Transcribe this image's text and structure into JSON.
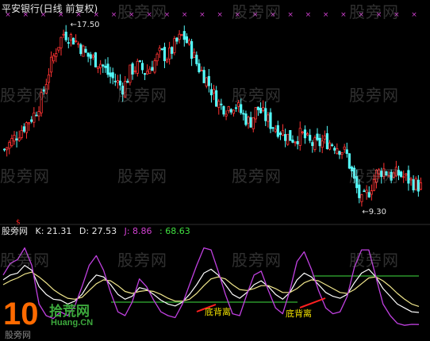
{
  "header": {
    "title": "平安银行(日线 前复权)"
  },
  "indicator": {
    "name": "股旁网",
    "k_label": "K: 21.31",
    "d_label": "D: 27.53",
    "j_label": "J: 8.86",
    "x_label": ": 68.63"
  },
  "watermark": "股旁网",
  "logo": {
    "num": "10",
    "cn": "拾荒网",
    "url": "Huang.CN",
    "sub": "股旁网"
  },
  "colors": {
    "up": "#ff3232",
    "down": "#54fcfc",
    "marker": "#d040d0",
    "k_line": "#ffffff",
    "d_line": "#f0e68c",
    "j_line": "#c040e0",
    "level_line": "#40e040",
    "annotation": "#f0e000",
    "red_marker": "#ff2020"
  },
  "chart_data": [
    {
      "type": "candlestick",
      "title": "平安银行(日线 前复权)",
      "annotations": [
        {
          "text": "17.50",
          "kind": "high"
        },
        {
          "text": "9.30",
          "kind": "low"
        }
      ],
      "marker_rows": {
        "x_marks": 24,
        "note": "x markers across top"
      },
      "close_path": [
        12.0,
        12.4,
        12.8,
        13.2,
        13.6,
        14.3,
        15.6,
        16.6,
        17.3,
        17.1,
        16.8,
        16.3,
        16.1,
        15.9,
        15.4,
        15.1,
        14.8,
        15.6,
        15.8,
        15.5,
        15.9,
        16.4,
        16.2,
        16.8,
        17.2,
        16.6,
        15.8,
        15.3,
        14.6,
        14.0,
        13.9,
        14.1,
        13.6,
        13.2,
        13.9,
        13.5,
        13.1,
        12.9,
        12.6,
        12.5,
        12.7,
        12.3,
        12.2,
        12.4,
        12.3,
        12.1,
        11.8,
        10.6,
        9.6,
        10.1,
        10.9,
        11.1,
        10.8,
        10.9,
        10.7,
        10.5,
        10.3
      ]
    },
    {
      "type": "line",
      "title": "股旁网",
      "series": [
        {
          "name": "K",
          "values": [
            55,
            60,
            62,
            70,
            65,
            48,
            40,
            35,
            34,
            30,
            33,
            40,
            52,
            60,
            58,
            50,
            40,
            35,
            38,
            47,
            45,
            40,
            34,
            30,
            28,
            32,
            40,
            50,
            62,
            66,
            60,
            50,
            40,
            36,
            42,
            50,
            54,
            48,
            40,
            35,
            42,
            55,
            62,
            58,
            50,
            42,
            38,
            36,
            40,
            52,
            62,
            66,
            58,
            46,
            38,
            30,
            26,
            22,
            21.31
          ]
        },
        {
          "name": "D",
          "values": [
            50,
            54,
            57,
            61,
            63,
            58,
            52,
            45,
            40,
            36,
            35,
            37,
            44,
            51,
            55,
            54,
            49,
            43,
            41,
            43,
            44,
            43,
            40,
            36,
            33,
            33,
            35,
            41,
            49,
            56,
            58,
            56,
            50,
            45,
            44,
            46,
            49,
            49,
            46,
            42,
            42,
            46,
            52,
            55,
            54,
            50,
            46,
            42,
            41,
            45,
            51,
            57,
            58,
            54,
            48,
            41,
            35,
            30,
            27.53
          ]
        },
        {
          "name": "J",
          "values": [
            60,
            72,
            76,
            88,
            70,
            30,
            18,
            15,
            22,
            18,
            28,
            48,
            70,
            80,
            65,
            42,
            22,
            18,
            32,
            56,
            48,
            34,
            22,
            18,
            16,
            30,
            50,
            70,
            88,
            86,
            64,
            40,
            20,
            18,
            40,
            60,
            64,
            44,
            26,
            20,
            44,
            74,
            84,
            66,
            44,
            26,
            20,
            22,
            38,
            68,
            86,
            86,
            58,
            30,
            18,
            10,
            8,
            9,
            8.86
          ]
        },
        {
          "name": "",
          "values": [
            68.63
          ]
        }
      ],
      "annotations": [
        "底背离",
        "底背离"
      ]
    }
  ]
}
